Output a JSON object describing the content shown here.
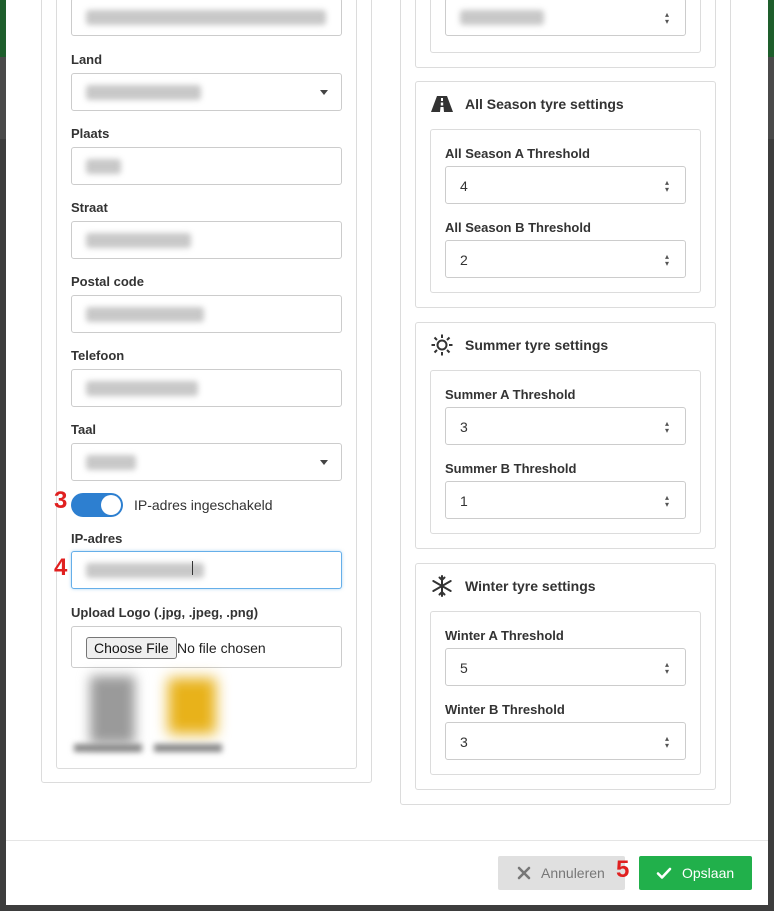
{
  "form": {
    "land_label": "Land",
    "plaats_label": "Plaats",
    "straat_label": "Straat",
    "postal_label": "Postal code",
    "telefoon_label": "Telefoon",
    "taal_label": "Taal",
    "ip_toggle_label": "IP-adres ingeschakeld",
    "ip_toggle_on": true,
    "ip_label": "IP-adres",
    "upload_label": "Upload Logo (.jpg, .jpeg, .png)",
    "file_button": "Choose File",
    "file_status": "No file chosen"
  },
  "steps": {
    "toggle": "3",
    "ip_field": "4",
    "save": "5"
  },
  "all_season": {
    "title": "All Season tyre settings",
    "a_label": "All Season A Threshold",
    "a_value": "4",
    "b_label": "All Season B Threshold",
    "b_value": "2"
  },
  "summer": {
    "title": "Summer tyre settings",
    "a_label": "Summer A Threshold",
    "a_value": "3",
    "b_label": "Summer B Threshold",
    "b_value": "1"
  },
  "winter": {
    "title": "Winter tyre settings",
    "a_label": "Winter A Threshold",
    "a_value": "5",
    "b_label": "Winter B Threshold",
    "b_value": "3"
  },
  "footer": {
    "cancel_label": "Annuleren",
    "save_label": "Opslaan"
  },
  "colors": {
    "accent": "#2d7fd0",
    "save": "#21b04b",
    "step": "#e02020",
    "header_green": "#1e5e2c"
  }
}
